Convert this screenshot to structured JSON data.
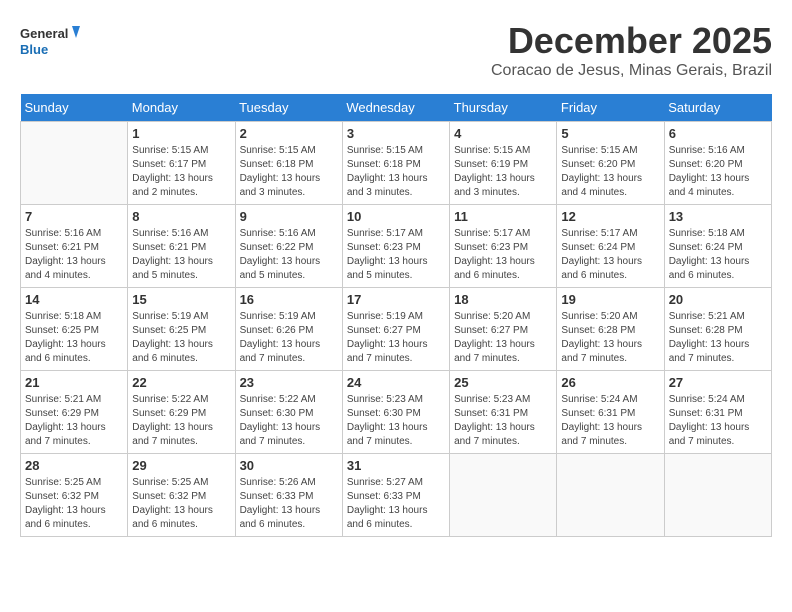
{
  "logo": {
    "line1": "General",
    "line2": "Blue"
  },
  "title": "December 2025",
  "subtitle": "Coracao de Jesus, Minas Gerais, Brazil",
  "days_header": [
    "Sunday",
    "Monday",
    "Tuesday",
    "Wednesday",
    "Thursday",
    "Friday",
    "Saturday"
  ],
  "weeks": [
    [
      {
        "day": "",
        "info": ""
      },
      {
        "day": "1",
        "info": "Sunrise: 5:15 AM\nSunset: 6:17 PM\nDaylight: 13 hours\nand 2 minutes."
      },
      {
        "day": "2",
        "info": "Sunrise: 5:15 AM\nSunset: 6:18 PM\nDaylight: 13 hours\nand 3 minutes."
      },
      {
        "day": "3",
        "info": "Sunrise: 5:15 AM\nSunset: 6:18 PM\nDaylight: 13 hours\nand 3 minutes."
      },
      {
        "day": "4",
        "info": "Sunrise: 5:15 AM\nSunset: 6:19 PM\nDaylight: 13 hours\nand 3 minutes."
      },
      {
        "day": "5",
        "info": "Sunrise: 5:15 AM\nSunset: 6:20 PM\nDaylight: 13 hours\nand 4 minutes."
      },
      {
        "day": "6",
        "info": "Sunrise: 5:16 AM\nSunset: 6:20 PM\nDaylight: 13 hours\nand 4 minutes."
      }
    ],
    [
      {
        "day": "7",
        "info": "Sunrise: 5:16 AM\nSunset: 6:21 PM\nDaylight: 13 hours\nand 4 minutes."
      },
      {
        "day": "8",
        "info": "Sunrise: 5:16 AM\nSunset: 6:21 PM\nDaylight: 13 hours\nand 5 minutes."
      },
      {
        "day": "9",
        "info": "Sunrise: 5:16 AM\nSunset: 6:22 PM\nDaylight: 13 hours\nand 5 minutes."
      },
      {
        "day": "10",
        "info": "Sunrise: 5:17 AM\nSunset: 6:23 PM\nDaylight: 13 hours\nand 5 minutes."
      },
      {
        "day": "11",
        "info": "Sunrise: 5:17 AM\nSunset: 6:23 PM\nDaylight: 13 hours\nand 6 minutes."
      },
      {
        "day": "12",
        "info": "Sunrise: 5:17 AM\nSunset: 6:24 PM\nDaylight: 13 hours\nand 6 minutes."
      },
      {
        "day": "13",
        "info": "Sunrise: 5:18 AM\nSunset: 6:24 PM\nDaylight: 13 hours\nand 6 minutes."
      }
    ],
    [
      {
        "day": "14",
        "info": "Sunrise: 5:18 AM\nSunset: 6:25 PM\nDaylight: 13 hours\nand 6 minutes."
      },
      {
        "day": "15",
        "info": "Sunrise: 5:19 AM\nSunset: 6:25 PM\nDaylight: 13 hours\nand 6 minutes."
      },
      {
        "day": "16",
        "info": "Sunrise: 5:19 AM\nSunset: 6:26 PM\nDaylight: 13 hours\nand 7 minutes."
      },
      {
        "day": "17",
        "info": "Sunrise: 5:19 AM\nSunset: 6:27 PM\nDaylight: 13 hours\nand 7 minutes."
      },
      {
        "day": "18",
        "info": "Sunrise: 5:20 AM\nSunset: 6:27 PM\nDaylight: 13 hours\nand 7 minutes."
      },
      {
        "day": "19",
        "info": "Sunrise: 5:20 AM\nSunset: 6:28 PM\nDaylight: 13 hours\nand 7 minutes."
      },
      {
        "day": "20",
        "info": "Sunrise: 5:21 AM\nSunset: 6:28 PM\nDaylight: 13 hours\nand 7 minutes."
      }
    ],
    [
      {
        "day": "21",
        "info": "Sunrise: 5:21 AM\nSunset: 6:29 PM\nDaylight: 13 hours\nand 7 minutes."
      },
      {
        "day": "22",
        "info": "Sunrise: 5:22 AM\nSunset: 6:29 PM\nDaylight: 13 hours\nand 7 minutes."
      },
      {
        "day": "23",
        "info": "Sunrise: 5:22 AM\nSunset: 6:30 PM\nDaylight: 13 hours\nand 7 minutes."
      },
      {
        "day": "24",
        "info": "Sunrise: 5:23 AM\nSunset: 6:30 PM\nDaylight: 13 hours\nand 7 minutes."
      },
      {
        "day": "25",
        "info": "Sunrise: 5:23 AM\nSunset: 6:31 PM\nDaylight: 13 hours\nand 7 minutes."
      },
      {
        "day": "26",
        "info": "Sunrise: 5:24 AM\nSunset: 6:31 PM\nDaylight: 13 hours\nand 7 minutes."
      },
      {
        "day": "27",
        "info": "Sunrise: 5:24 AM\nSunset: 6:31 PM\nDaylight: 13 hours\nand 7 minutes."
      }
    ],
    [
      {
        "day": "28",
        "info": "Sunrise: 5:25 AM\nSunset: 6:32 PM\nDaylight: 13 hours\nand 6 minutes."
      },
      {
        "day": "29",
        "info": "Sunrise: 5:25 AM\nSunset: 6:32 PM\nDaylight: 13 hours\nand 6 minutes."
      },
      {
        "day": "30",
        "info": "Sunrise: 5:26 AM\nSunset: 6:33 PM\nDaylight: 13 hours\nand 6 minutes."
      },
      {
        "day": "31",
        "info": "Sunrise: 5:27 AM\nSunset: 6:33 PM\nDaylight: 13 hours\nand 6 minutes."
      },
      {
        "day": "",
        "info": ""
      },
      {
        "day": "",
        "info": ""
      },
      {
        "day": "",
        "info": ""
      }
    ]
  ]
}
